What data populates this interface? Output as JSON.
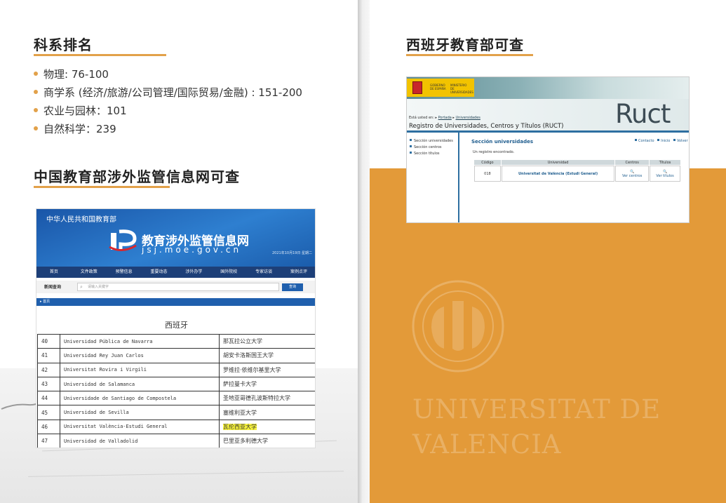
{
  "left": {
    "section1": {
      "title": "科系排名",
      "items": [
        "物理: 76-100",
        "商学系 (经济/旅游/公司管理/国际贸易/金融) : 151-200",
        "农业与园林：101",
        "自然科学：239"
      ]
    },
    "section2": {
      "title": "中国教育部涉外监管信息网可查"
    },
    "moe": {
      "ministry": "中华人民共和国教育部",
      "site_title": "教育涉外监管信息网",
      "site_url": "jsj.moe.gov.cn",
      "date": "2021年10月19日 星期二",
      "nav": [
        "首页",
        "文件政策",
        "预警信息",
        "重要动态",
        "涉外办学",
        "国外院校",
        "专家访谈",
        "案例点评"
      ],
      "search_label": "新闻查询",
      "search_placeholder": "请输入关键字",
      "search_button": "查询",
      "breadcrumb": "首页",
      "country": "西班牙",
      "rows": [
        {
          "num": "40",
          "es": "Universidad Pública de Navarra",
          "zh": "那瓦拉公立大学",
          "highlight": false
        },
        {
          "num": "41",
          "es": "Universidad Rey Juan Carlos",
          "zh": "胡安卡洛斯国王大学",
          "highlight": false
        },
        {
          "num": "42",
          "es": "Universitat Rovira i Virgili",
          "zh": "罗维拉·依维尔基里大学",
          "highlight": false
        },
        {
          "num": "43",
          "es": "Universidad de Salamanca",
          "zh": "萨拉曼卡大学",
          "highlight": false
        },
        {
          "num": "44",
          "es": "Universidade de Santiago de Compostela",
          "zh": "圣地亚哥德孔波斯特拉大学",
          "highlight": false
        },
        {
          "num": "45",
          "es": "Universidad de Sevilla",
          "zh": "塞维利亚大学",
          "highlight": false
        },
        {
          "num": "46",
          "es": "Universitat València-Estudi General",
          "zh": "瓦伦西亚大学",
          "highlight": true
        },
        {
          "num": "47",
          "es": "Universidad de Valladolid",
          "zh": "巴里亚多利德大学",
          "highlight": false
        }
      ]
    }
  },
  "right": {
    "section": {
      "title": "西班牙教育部可查"
    },
    "ruct": {
      "gov_label_1": "GOBIERNO",
      "gov_label_2": "DE ESPAÑA",
      "ministry_label_1": "MINISTERIO",
      "ministry_label_2": "DE UNIVERSIDADES",
      "crumb_prefix": "Está usted en:",
      "crumb_link1": "Portada",
      "crumb_link2": "Universidades",
      "register_title": "Registro de Universidades, Centros y Títulos (RUCT)",
      "logo": "Ruct",
      "side_links": [
        "Sección universidades",
        "Sección centros",
        "Sección títulos"
      ],
      "main_title": "Sección universidades",
      "top_links": [
        "Contacto",
        "Inicio",
        "Volver"
      ],
      "found_text": "Un registro encontrado.",
      "headers": [
        "Código",
        "Universidad",
        "Centros",
        "Títulos"
      ],
      "row": {
        "code": "018",
        "university": "Universitat de València (Estudi General)",
        "centros": "Ver centros",
        "titulos": "Ver títulos"
      }
    },
    "watermark": {
      "line1": "UNIVERSITAT DE",
      "line2": "VALENCIA"
    }
  },
  "colors": {
    "accent": "#e2a14a",
    "orange_panel": "#e39a39",
    "moe_blue": "#1f5fad",
    "ruct_blue": "#2e6fa1"
  }
}
